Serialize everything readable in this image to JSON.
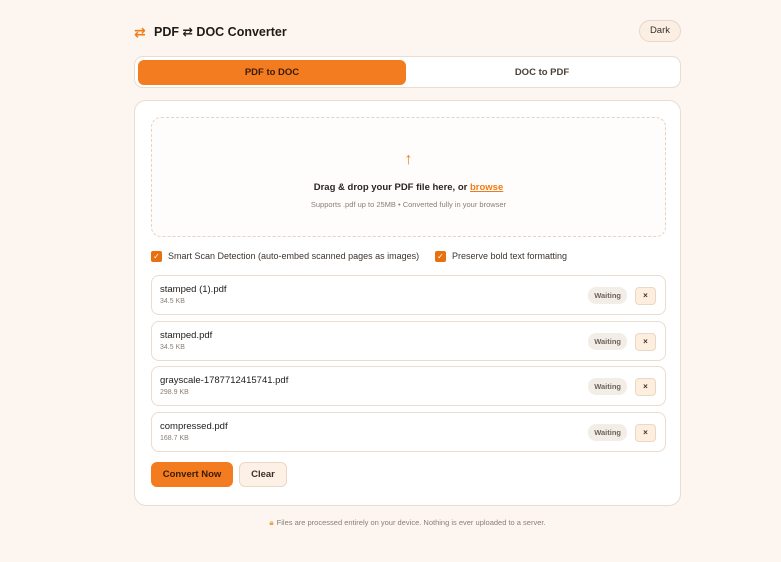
{
  "header": {
    "brand_icon": "swap-arrows-icon",
    "title": "PDF ⇄ DOC Converter",
    "theme_toggle": "Dark"
  },
  "tabs": [
    {
      "label": "PDF to DOC",
      "active": true
    },
    {
      "label": "DOC to PDF",
      "active": false
    }
  ],
  "dropzone": {
    "icon": "upload-arrow-icon",
    "text": "Drag & drop your PDF file here, or",
    "browse_label": "browse",
    "subtext": "Supports .pdf up to 25MB • Converted fully in your browser"
  },
  "options": [
    {
      "label": "Smart Scan Detection (auto-embed scanned pages as images)",
      "checked": true
    },
    {
      "label": "Preserve bold text formatting",
      "checked": true
    }
  ],
  "files": [
    {
      "name": "stamped (1).pdf",
      "size": "34.5 KB",
      "status": "Waiting"
    },
    {
      "name": "stamped.pdf",
      "size": "34.5 KB",
      "status": "Waiting"
    },
    {
      "name": "grayscale-1787712415741.pdf",
      "size": "298.9 KB",
      "status": "Waiting"
    },
    {
      "name": "compressed.pdf",
      "size": "168.7 KB",
      "status": "Waiting"
    }
  ],
  "remove_label": "×",
  "actions": {
    "convert_label": "Convert Now",
    "clear_label": "Clear"
  },
  "footer": {
    "text": "Files are processed entirely on your device. Nothing is ever uploaded to a server."
  },
  "colors": {
    "accent": "#f47c20",
    "background": "#fdf6f0",
    "card": "#ffffff",
    "border": "#eadccf"
  }
}
